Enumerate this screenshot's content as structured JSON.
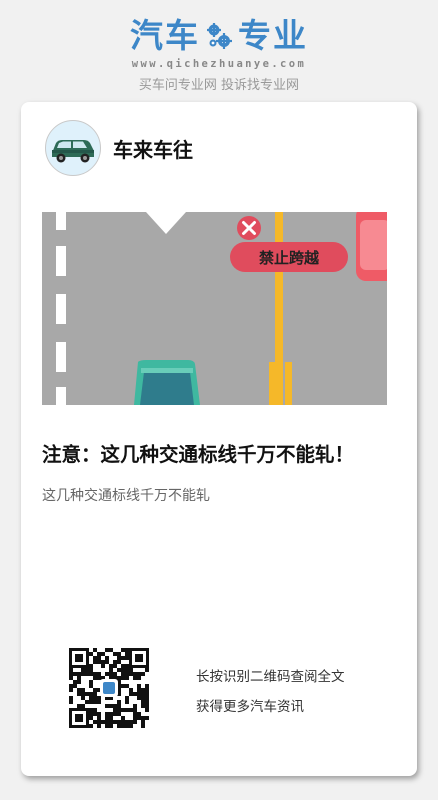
{
  "header": {
    "logo_left": "汽车",
    "logo_right": "专业",
    "gear_icon": "gear-icon",
    "url": "www.qichezhuanye.com",
    "tagline": "买车问专业网 投诉找专业网",
    "brand_color": "#3d87c8"
  },
  "card": {
    "account_name": "车来车往",
    "avatar_icon": "car-icon",
    "cover": {
      "sign_text": "禁止跨越",
      "close_icon": "close-icon"
    },
    "title": "注意：这几种交通标线千万不能轧！",
    "description": "这几种交通标线千万不能轧",
    "qr": {
      "line1": "长按识别二维码查阅全文",
      "line2": "获得更多汽车资讯"
    }
  }
}
